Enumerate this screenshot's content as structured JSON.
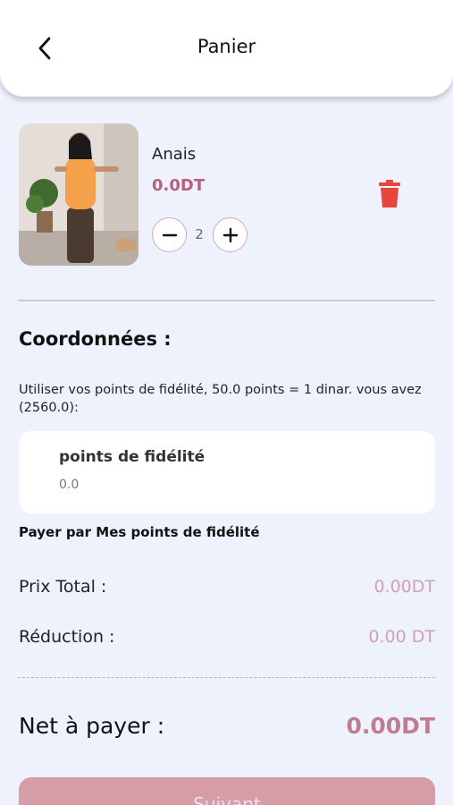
{
  "header": {
    "title": "Panier"
  },
  "cart": {
    "items": [
      {
        "name": "Anais",
        "price": "0.0DT",
        "quantity": "2"
      }
    ]
  },
  "coordinates": {
    "title": "Coordonnées :",
    "fidelity_info": "Utiliser vos points de fidélité, 50.0 points = 1 dinar. vous avez (2560.0):",
    "points_label": "points de fidélité",
    "points_value": "0.0",
    "pay_with_points": "Payer par Mes points de fidélité"
  },
  "summary": {
    "total_label": "Prix Total :",
    "total_value": "0.00DT",
    "discount_label": "Réduction :",
    "discount_value": "0.00 DT",
    "net_label": "Net à payer :",
    "net_value": "0.00DT"
  },
  "actions": {
    "next_label": "Suivant"
  },
  "colors": {
    "accent": "#b8607a",
    "button": "#d69da9",
    "delete": "#e8453c",
    "background": "#eef2fc"
  }
}
